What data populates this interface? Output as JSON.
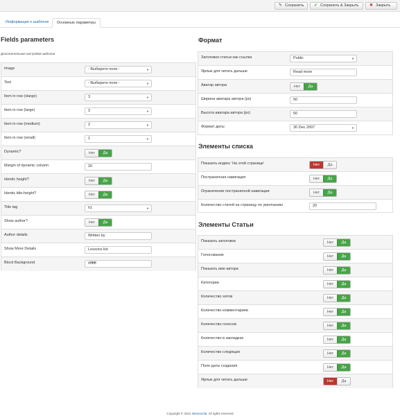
{
  "toolbar": {
    "save_label": "Сохранить",
    "save_close_label": "Сохранить & Закрыть",
    "close_label": "Закрыть"
  },
  "tabs": [
    {
      "label": "Информация о шаблоне"
    },
    {
      "label": "Основные параметры"
    }
  ],
  "fields": {
    "title": "Fields parameters",
    "description": "Дополнительные настройки шаблона",
    "rows": [
      {
        "label": "Image",
        "value": "- Выберите поле -"
      },
      {
        "label": "Text",
        "value": "- Выберите поле -"
      },
      {
        "label": "Item in row (xlarge)",
        "value": "3"
      },
      {
        "label": "Item in row (large)",
        "value": "3"
      },
      {
        "label": "Item in row (medium)",
        "value": "2"
      },
      {
        "label": "Item in row (small)",
        "value": "1"
      },
      {
        "label": "Dynamic?",
        "no": "Нет",
        "yes": "Да",
        "state": "yes"
      },
      {
        "label": "Margin of dynamic column",
        "value": "20"
      },
      {
        "label": "Identic height?",
        "no": "Нет",
        "yes": "Да",
        "state": "yes"
      },
      {
        "label": "Identic title-height?",
        "no": "Нет",
        "yes": "Да",
        "state": "yes"
      },
      {
        "label": "Title tag",
        "value": "h1"
      },
      {
        "label": "Show author?",
        "no": "Нет",
        "yes": "Да",
        "state": "yes"
      },
      {
        "label": "Author details",
        "value": "Written by"
      },
      {
        "label": "Show More Details",
        "value": "Lessons list"
      },
      {
        "label": "Block Background",
        "value": "#ffffff"
      }
    ]
  },
  "format": {
    "title": "Формат",
    "rows": [
      {
        "label": "Заголовок статьи как ссылка",
        "value": "Public"
      },
      {
        "label": "Ярлык для читать дальше",
        "value": "Read more"
      },
      {
        "label": "Аватар автора",
        "no": "Нет",
        "yes": "Да",
        "state": "yes"
      },
      {
        "label": "Ширина аватара автора (px)",
        "value": "50"
      },
      {
        "label": "Высота аватара автора (px)",
        "value": "50"
      },
      {
        "label": "Формат даты",
        "value": "30 Dec 2007"
      }
    ]
  },
  "list": {
    "title": "Элементы списка",
    "rows": [
      {
        "label": "Показать индекс 'На этой странице'",
        "no": "Нет",
        "yes": "Да",
        "state": "no"
      },
      {
        "label": "Постраничная навигация",
        "no": "Нет",
        "yes": "Да",
        "state": "yes"
      },
      {
        "label": "Ограничение постраничной навигации",
        "no": "Нет",
        "yes": "Да",
        "state": "yes"
      },
      {
        "label": "Количество статей на страницу по умолчанию",
        "value": "20"
      }
    ]
  },
  "article": {
    "title": "Элементы Статьи",
    "rows": [
      {
        "label": "Показать заголовок",
        "no": "Нет",
        "yes": "Да",
        "state": "yes"
      },
      {
        "label": "Голосование",
        "no": "Нет",
        "yes": "Да",
        "state": "yes"
      },
      {
        "label": "Показать имя автора",
        "no": "Нет",
        "yes": "Да",
        "state": "yes"
      },
      {
        "label": "Категории",
        "no": "Нет",
        "yes": "Да",
        "state": "yes"
      },
      {
        "label": "Количество хитов",
        "no": "Нет",
        "yes": "Да",
        "state": "yes"
      },
      {
        "label": "Количество комментариев",
        "no": "Нет",
        "yes": "Да",
        "state": "yes"
      },
      {
        "label": "Количество голосов",
        "no": "Нет",
        "yes": "Да",
        "state": "yes"
      },
      {
        "label": "Количество в закладках",
        "no": "Нет",
        "yes": "Да",
        "state": "yes"
      },
      {
        "label": "Количество следящих",
        "no": "Нет",
        "yes": "Да",
        "state": "yes"
      },
      {
        "label": "Поле даты создания",
        "no": "Нет",
        "yes": "Да",
        "state": "yes"
      },
      {
        "label": "Ярлык для читать дальше",
        "no": "Нет",
        "yes": "Да",
        "state": "no"
      }
    ]
  },
  "footer": {
    "prefix": "Copyright © 2012",
    "link": "NetJoomla",
    "suffix": ". All rights reserved"
  },
  "colors": {
    "yes_active": "#47a447",
    "no_active": "#bd362f",
    "link": "#1a67a3"
  }
}
